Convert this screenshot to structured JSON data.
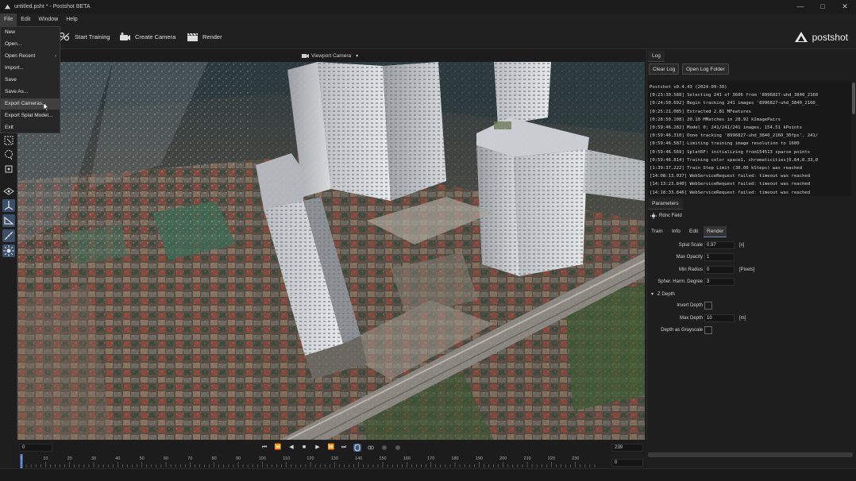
{
  "window": {
    "title": "untitled.psht * - Postshot BETA",
    "controls": [
      "—",
      "□",
      "✕"
    ]
  },
  "menubar": {
    "items": [
      "File",
      "Edit",
      "Window",
      "Help"
    ]
  },
  "file_menu": {
    "items": [
      {
        "label": "New",
        "arrow": ""
      },
      {
        "label": "Open...",
        "arrow": ""
      },
      {
        "label": "Open Recent",
        "arrow": "›"
      },
      {
        "label": "Import...",
        "arrow": ""
      },
      {
        "label": "Save",
        "arrow": ""
      },
      {
        "label": "Save As...",
        "arrow": ""
      },
      {
        "label": "Export Cameras...",
        "arrow": ""
      },
      {
        "label": "Export Splat Model...",
        "arrow": ""
      },
      {
        "label": "Exit",
        "arrow": ""
      }
    ],
    "highlighted": "Export Cameras..."
  },
  "toolbar": {
    "start_training": "Start Training",
    "create_camera": "Create Camera",
    "render": "Render",
    "logo": "postshot"
  },
  "viewport": {
    "tab_label": "Viewport Camera",
    "tab_arrow": "▾"
  },
  "log_panel": {
    "tab": "Log",
    "clear_button": "Clear Log",
    "open_folder_button": "Open Log Folder",
    "lines": [
      "Postshot v0.4.43 (2024-09-30)",
      "[0:23:30.588] Selecting 241 of 3606 from '8996827-uhd_3840_2160",
      "[0:24:50.692] Begin tracking 241 images '8996827-uhd_3840_2160_",
      "[0:25:21.085] Extracted 2.81 MFeatures",
      "[0:28:50.108] 20.10 MMatches in 28.92 kImagePairs",
      "[0:59:46.282] Model 0: 241/241/241 images, 154.51 kPoints",
      "[0:59:46.310] Done tracking '8996827-uhd_3840_2160_30fps'. 241/",
      "[0:59:46.587] Limiting training image resolution to 1600",
      "[0:59:46.569] SplatRF: initializing from154513 sparse points",
      "[0:59:46.814] Training color space1, chromaticities[0.64,0.33,0",
      "[1:39:37.222] Train Step Limit (30.00 kSteps) was reached",
      "[14:08:13.037] WebServiceRequest failed: timeout was reached",
      "[14:13:23.840] WebServiceRequest failed: timeout was reached",
      "[14:18:33.846] WebServiceRequest failed: timeout was reached"
    ]
  },
  "parameters_panel": {
    "tab": "Parameters",
    "node_name": "Rdnc Field",
    "subtabs": [
      "Train",
      "Info",
      "Edit",
      "Render"
    ],
    "active_subtab": "Render",
    "fields": [
      {
        "label": "Splat Scale",
        "value": "0.97",
        "unit": "[x]"
      },
      {
        "label": "Max Opacity",
        "value": "1",
        "unit": ""
      },
      {
        "label": "Min Radius",
        "value": "0",
        "unit": "[Pixels]"
      },
      {
        "label": "Spher. Harm. Degree",
        "value": "3",
        "unit": ""
      }
    ],
    "z_depth_section": "Z Depth",
    "z_depth_arrow": "▾",
    "invert_depth": "Invert Depth",
    "max_depth": {
      "label": "Max Depth",
      "value": "10",
      "unit": "[m]"
    },
    "depth_grayscale": "Depth as Grayscale"
  },
  "transport": {
    "start_frame": "0",
    "end_frame": "239",
    "current_frame": "0",
    "controls": [
      "⏮",
      "⏪",
      "◀",
      "■",
      "▶",
      "⏩",
      "⏭"
    ]
  },
  "timeline": {
    "ticks": [
      "0",
      "10",
      "20",
      "30",
      "40",
      "50",
      "60",
      "70",
      "80",
      "90",
      "100",
      "110",
      "120",
      "130",
      "140",
      "150",
      "160",
      "170",
      "180",
      "190",
      "200",
      "210",
      "220",
      "230"
    ]
  },
  "colors": {
    "accent": "#3b5a80",
    "background": "#1e1e1e",
    "menu_highlight": "#404040"
  }
}
